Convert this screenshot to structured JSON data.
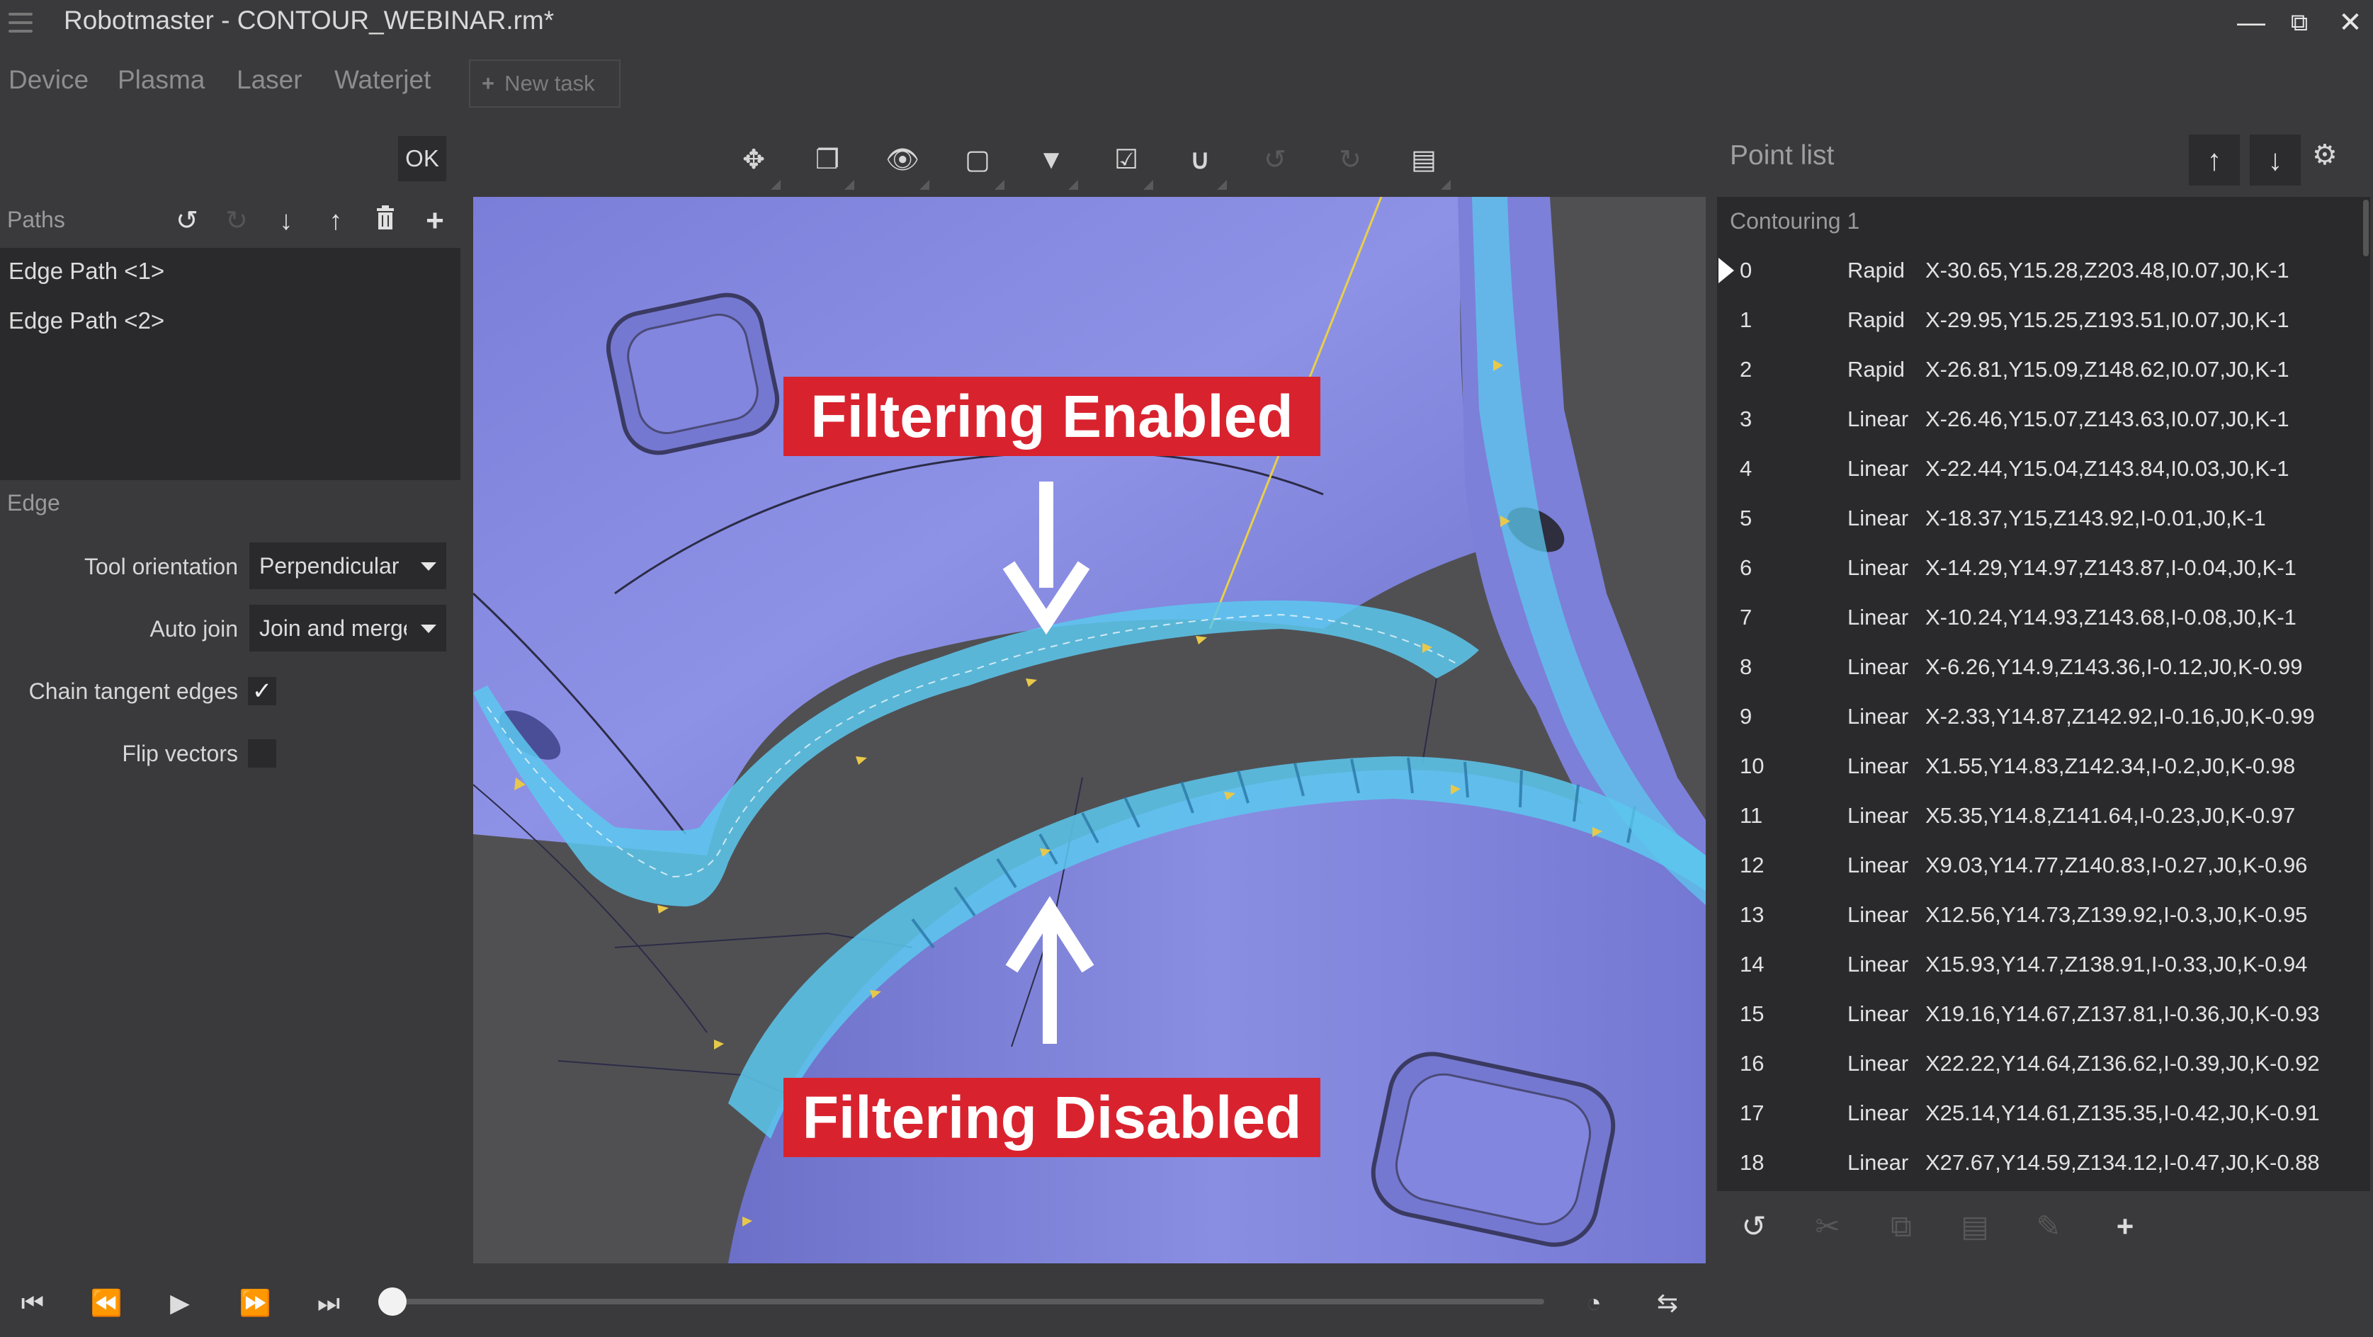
{
  "app": {
    "title": "Robotmaster - CONTOUR_WEBINAR.rm*",
    "window_controls": {
      "minimize": "minimize-icon",
      "restore": "restore-icon",
      "close": "close-icon"
    }
  },
  "menu": {
    "items": [
      "Device",
      "Plasma",
      "Laser",
      "Waterjet"
    ],
    "new_task": "New task"
  },
  "left_panel": {
    "ok_label": "OK",
    "paths_label": "Paths",
    "paths": [
      "Edge Path <1>",
      "Edge Path <2>"
    ],
    "edge_label": "Edge",
    "props": {
      "tool_orientation_label": "Tool orientation",
      "tool_orientation_value": "Perpendicular",
      "auto_join_label": "Auto join",
      "auto_join_value": "Join and merge",
      "chain_tangent_label": "Chain tangent edges",
      "chain_tangent_checked": true,
      "flip_vectors_label": "Flip vectors",
      "flip_vectors_checked": false
    }
  },
  "viewport": {
    "banner_top": "Filtering Enabled",
    "banner_bottom": "Filtering Disabled",
    "colors": {
      "part": "#8688de",
      "path": "#5cc8ee",
      "banner": "#d8232f",
      "background": "#4d4d50"
    }
  },
  "point_list": {
    "title": "Point list",
    "group": "Contouring 1",
    "rows": [
      {
        "idx": "0",
        "move": "Rapid",
        "coords": "X-30.65,Y15.28,Z203.48,I0.07,J0,K-1"
      },
      {
        "idx": "1",
        "move": "Rapid",
        "coords": "X-29.95,Y15.25,Z193.51,I0.07,J0,K-1"
      },
      {
        "idx": "2",
        "move": "Rapid",
        "coords": "X-26.81,Y15.09,Z148.62,I0.07,J0,K-1"
      },
      {
        "idx": "3",
        "move": "Linear",
        "coords": "X-26.46,Y15.07,Z143.63,I0.07,J0,K-1"
      },
      {
        "idx": "4",
        "move": "Linear",
        "coords": "X-22.44,Y15.04,Z143.84,I0.03,J0,K-1"
      },
      {
        "idx": "5",
        "move": "Linear",
        "coords": "X-18.37,Y15,Z143.92,I-0.01,J0,K-1"
      },
      {
        "idx": "6",
        "move": "Linear",
        "coords": "X-14.29,Y14.97,Z143.87,I-0.04,J0,K-1"
      },
      {
        "idx": "7",
        "move": "Linear",
        "coords": "X-10.24,Y14.93,Z143.68,I-0.08,J0,K-1"
      },
      {
        "idx": "8",
        "move": "Linear",
        "coords": "X-6.26,Y14.9,Z143.36,I-0.12,J0,K-0.99"
      },
      {
        "idx": "9",
        "move": "Linear",
        "coords": "X-2.33,Y14.87,Z142.92,I-0.16,J0,K-0.99"
      },
      {
        "idx": "10",
        "move": "Linear",
        "coords": "X1.55,Y14.83,Z142.34,I-0.2,J0,K-0.98"
      },
      {
        "idx": "11",
        "move": "Linear",
        "coords": "X5.35,Y14.8,Z141.64,I-0.23,J0,K-0.97"
      },
      {
        "idx": "12",
        "move": "Linear",
        "coords": "X9.03,Y14.77,Z140.83,I-0.27,J0,K-0.96"
      },
      {
        "idx": "13",
        "move": "Linear",
        "coords": "X12.56,Y14.73,Z139.92,I-0.3,J0,K-0.95"
      },
      {
        "idx": "14",
        "move": "Linear",
        "coords": "X15.93,Y14.7,Z138.91,I-0.33,J0,K-0.94"
      },
      {
        "idx": "15",
        "move": "Linear",
        "coords": "X19.16,Y14.67,Z137.81,I-0.36,J0,K-0.93"
      },
      {
        "idx": "16",
        "move": "Linear",
        "coords": "X22.22,Y14.64,Z136.62,I-0.39,J0,K-0.92"
      },
      {
        "idx": "17",
        "move": "Linear",
        "coords": "X25.14,Y14.61,Z135.35,I-0.42,J0,K-0.91"
      },
      {
        "idx": "18",
        "move": "Linear",
        "coords": "X27.67,Y14.59,Z134.12,I-0.47,J0,K-0.88"
      }
    ]
  },
  "icons": {
    "toolbar": [
      "fit-view-icon",
      "cube-icon",
      "eye-icon",
      "wireframe-cube-icon",
      "filter-icon",
      "checkbox-icon",
      "magnet-icon",
      "undo-icon",
      "redo-icon",
      "ruler-icon"
    ],
    "path_tools": [
      "undo-icon",
      "redo-icon",
      "move-down-icon",
      "move-up-icon",
      "trash-icon",
      "plus-icon"
    ],
    "point_tools": [
      "undo-icon",
      "scissors-icon",
      "copy-icon",
      "paste-icon",
      "edit-icon",
      "plus-icon"
    ],
    "playback": [
      "skip-start-icon",
      "rewind-icon",
      "play-icon",
      "fast-forward-icon",
      "skip-end-icon",
      "speed-gauge-icon",
      "loop-icon"
    ]
  }
}
